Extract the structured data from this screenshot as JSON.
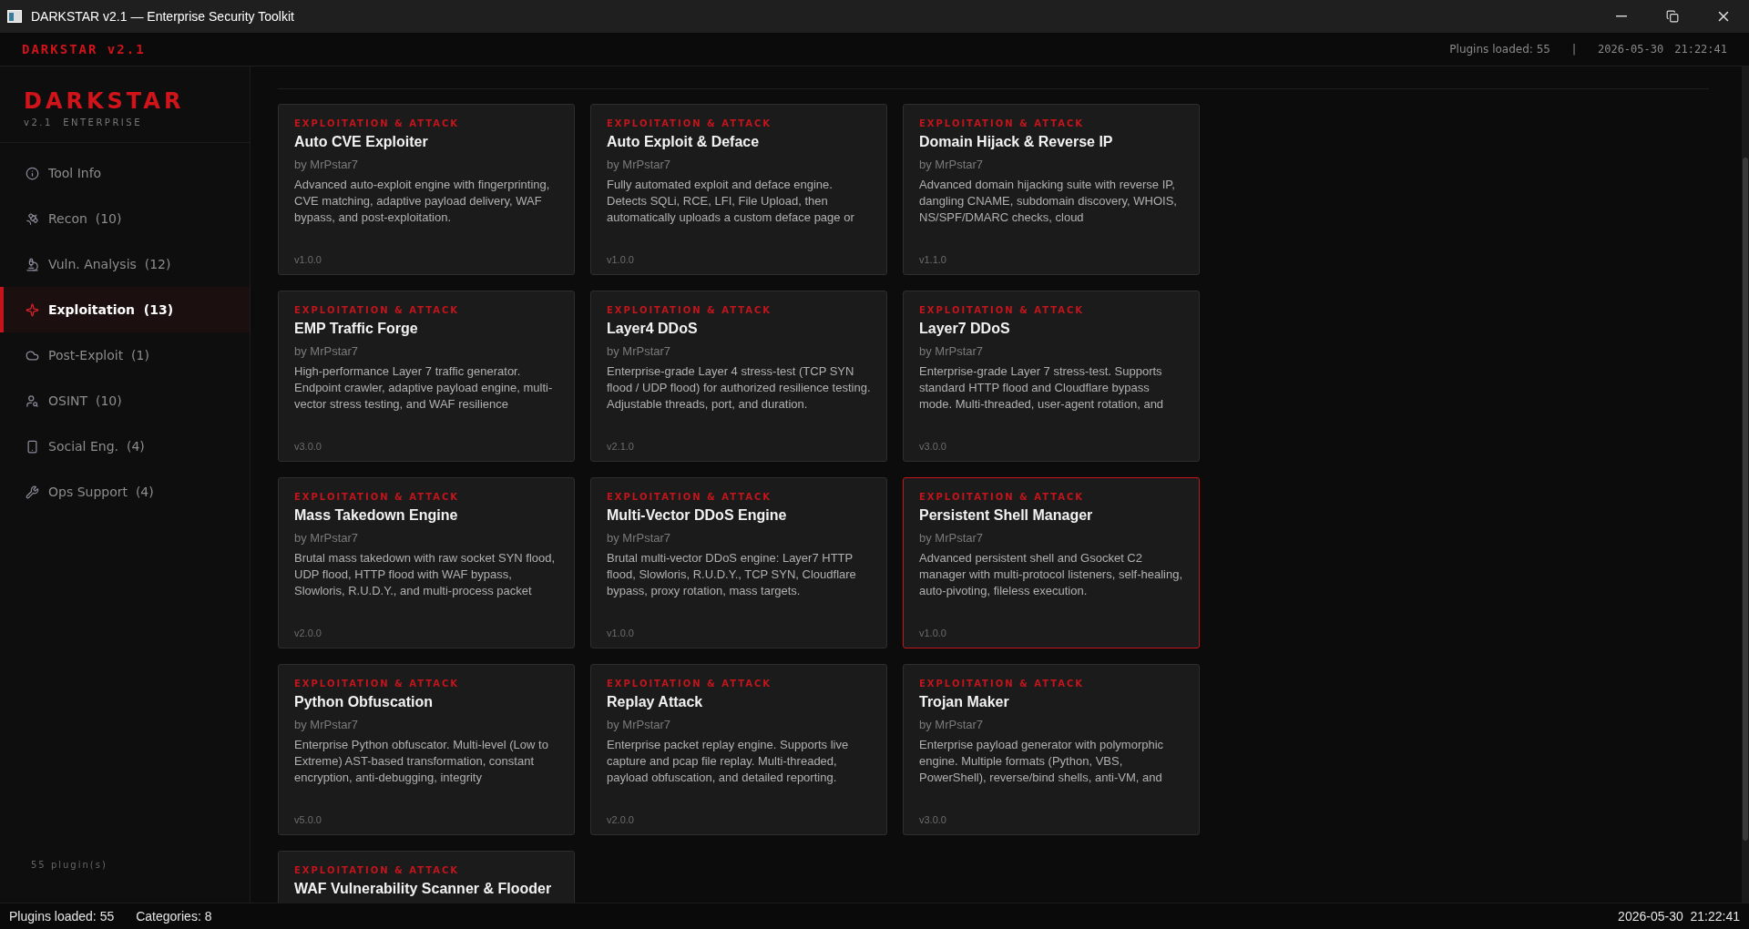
{
  "window": {
    "title": "DARKSTAR v2.1 — Enterprise Security Toolkit"
  },
  "header": {
    "brand": "DARKSTAR v2.1",
    "plugins": "Plugins loaded: 55",
    "separator": "|",
    "date": "2026-05-30",
    "time": "21:22:41"
  },
  "sidebar": {
    "logo": "DARKSTAR",
    "subtitle": "v2.1  ENTERPRISE",
    "items": [
      {
        "label": "Tool Info",
        "selected": false
      },
      {
        "label": "Recon",
        "count": "(10)",
        "selected": false
      },
      {
        "label": "Vuln. Analysis",
        "count": "(12)",
        "selected": false
      },
      {
        "label": "Exploitation",
        "count": "(13)",
        "selected": true
      },
      {
        "label": "Post-Exploit",
        "count": "(1)",
        "selected": false
      },
      {
        "label": "OSINT",
        "count": "(10)",
        "selected": false
      },
      {
        "label": "Social Eng.",
        "count": "(4)",
        "selected": false
      },
      {
        "label": "Ops Support",
        "count": "(4)",
        "selected": false
      }
    ],
    "footer": "55 plugin(s)"
  },
  "cards": [
    {
      "category": "EXPLOITATION & ATTACK",
      "title": "Auto CVE Exploiter",
      "author": "by MrPstar7",
      "description": "Advanced auto-exploit engine with fingerprinting, CVE matching, adaptive payload delivery, WAF bypass, and post-exploitation.",
      "version": "v1.0.0",
      "selected": false
    },
    {
      "category": "EXPLOITATION & ATTACK",
      "title": "Auto Exploit & Deface",
      "author": "by MrPstar7",
      "description": "Fully automated exploit and deface engine. Detects SQLi, RCE, LFI, File Upload, then automatically uploads a custom deface page or",
      "version": "v1.0.0",
      "selected": false
    },
    {
      "category": "EXPLOITATION & ATTACK",
      "title": "Domain Hijack & Reverse IP",
      "author": "by MrPstar7",
      "description": "Advanced domain hijacking suite with reverse IP, dangling CNAME, subdomain discovery, WHOIS, NS/SPF/DMARC checks, cloud",
      "version": "v1.1.0",
      "selected": false
    },
    {
      "category": "EXPLOITATION & ATTACK",
      "title": "EMP Traffic Forge",
      "author": "by MrPstar7",
      "description": "High-performance Layer 7 traffic generator. Endpoint crawler, adaptive payload engine, multi-vector stress testing, and WAF resilience",
      "version": "v3.0.0",
      "selected": false
    },
    {
      "category": "EXPLOITATION & ATTACK",
      "title": "Layer4 DDoS",
      "author": "by MrPstar7",
      "description": "Enterprise-grade Layer 4 stress-test (TCP SYN flood / UDP flood) for authorized resilience testing. Adjustable threads, port, and duration.",
      "version": "v2.1.0",
      "selected": false
    },
    {
      "category": "EXPLOITATION & ATTACK",
      "title": "Layer7 DDoS",
      "author": "by MrPstar7",
      "description": "Enterprise-grade Layer 7 stress-test. Supports standard HTTP flood and Cloudflare bypass mode. Multi-threaded, user-agent rotation, and",
      "version": "v3.0.0",
      "selected": false
    },
    {
      "category": "EXPLOITATION & ATTACK",
      "title": "Mass Takedown Engine",
      "author": "by MrPstar7",
      "description": "Brutal mass takedown with raw socket SYN flood, UDP flood, HTTP flood with WAF bypass, Slowloris, R.U.D.Y., and multi-process packet",
      "version": "v2.0.0",
      "selected": false
    },
    {
      "category": "EXPLOITATION & ATTACK",
      "title": "Multi-Vector DDoS Engine",
      "author": "by MrPstar7",
      "description": "Brutal multi-vector DDoS engine: Layer7 HTTP flood, Slowloris, R.U.D.Y., TCP SYN, Cloudflare bypass, proxy rotation, mass targets.",
      "version": "v1.0.0",
      "selected": false
    },
    {
      "category": "EXPLOITATION & ATTACK",
      "title": "Persistent Shell Manager",
      "author": "by MrPstar7",
      "description": "Advanced persistent shell and Gsocket C2 manager with multi-protocol listeners, self-healing, auto-pivoting, fileless execution.",
      "version": "v1.0.0",
      "selected": true
    },
    {
      "category": "EXPLOITATION & ATTACK",
      "title": "Python Obfuscation",
      "author": "by MrPstar7",
      "description": "Enterprise Python obfuscator. Multi-level (Low to Extreme) AST-based transformation, constant encryption, anti-debugging, integrity",
      "version": "v5.0.0",
      "selected": false
    },
    {
      "category": "EXPLOITATION & ATTACK",
      "title": "Replay Attack",
      "author": "by MrPstar7",
      "description": "Enterprise packet replay engine. Supports live capture and pcap file replay. Multi-threaded, payload obfuscation, and detailed reporting.",
      "version": "v2.0.0",
      "selected": false
    },
    {
      "category": "EXPLOITATION & ATTACK",
      "title": "Trojan Maker",
      "author": "by MrPstar7",
      "description": "Enterprise payload generator with polymorphic engine. Multiple formats (Python, VBS, PowerShell), reverse/bind shells, anti-VM, and",
      "version": "v3.0.0",
      "selected": false
    },
    {
      "category": "EXPLOITATION & ATTACK",
      "title": "WAF Vulnerability Scanner & Flooder",
      "selected": false
    }
  ],
  "status_bar": {
    "plugins": "Plugins loaded: 55",
    "categories": "Categories: 8",
    "datetime": "2026-05-30  21:22:41"
  }
}
